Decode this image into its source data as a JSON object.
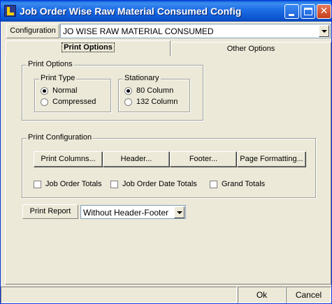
{
  "window": {
    "title": "Job Order Wise Raw Material Consumed Config"
  },
  "configuration": {
    "label": "Configuration",
    "value": "JO WISE RAW MATERIAL CONSUMED"
  },
  "tabs": [
    {
      "label": "Print Options",
      "active": true
    },
    {
      "label": "Other Options",
      "active": false
    }
  ],
  "print_options": {
    "legend": "Print Options",
    "print_type": {
      "legend": "Print Type",
      "options": [
        {
          "label": "Normal",
          "checked": true
        },
        {
          "label": "Compressed",
          "checked": false
        }
      ]
    },
    "stationary": {
      "legend": "Stationary",
      "options": [
        {
          "label": "80 Column",
          "checked": true
        },
        {
          "label": "132 Column",
          "checked": false
        }
      ]
    }
  },
  "print_configuration": {
    "legend": "Print Configuration",
    "buttons": [
      "Print Columns...",
      "Header...",
      "Footer...",
      "Page Formatting..."
    ],
    "checkboxes": [
      {
        "label": "Job Order Totals",
        "checked": false
      },
      {
        "label": "Job Order Date Totals",
        "checked": false
      },
      {
        "label": "Grand Totals",
        "checked": false
      }
    ]
  },
  "print_report": {
    "label": "Print Report",
    "value": "Without Header-Footer"
  },
  "footer": {
    "ok_label": "Ok",
    "cancel_label": "Cancel"
  },
  "colors": {
    "titlebar": "#0b55d0",
    "window_bg": "#ece9d8"
  },
  "icons": {
    "app": "app-logo-icon",
    "minimize": "minimize-icon",
    "maximize": "maximize-icon",
    "close": "close-icon"
  }
}
